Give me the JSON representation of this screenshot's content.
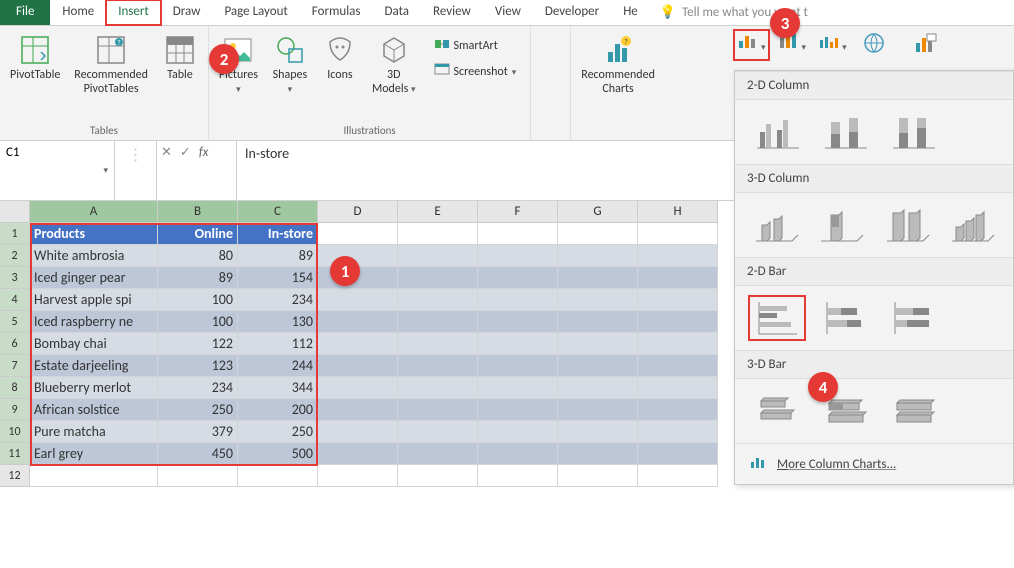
{
  "tabs": {
    "file": "File",
    "home": "Home",
    "insert": "Insert",
    "draw": "Draw",
    "pagelayout": "Page Layout",
    "formulas": "Formulas",
    "data": "Data",
    "review": "Review",
    "view": "View",
    "developer": "Developer",
    "help": "He",
    "tellme": "Tell me what you want t"
  },
  "ribbon": {
    "pivottable": "PivotTable",
    "recpivot": "Recommended\nPivotTables",
    "table": "Table",
    "tables_label": "Tables",
    "pictures": "Pictures",
    "shapes": "Shapes",
    "icons": "Icons",
    "models3d": "3D\nModels",
    "illus_label": "Illustrations",
    "smartart": "SmartArt",
    "screenshot": "Screenshot",
    "reccharts": "Recommended\nCharts"
  },
  "fmla": {
    "cellref": "C1",
    "value": "In-store"
  },
  "columns": [
    "A",
    "B",
    "C",
    "D",
    "E",
    "F",
    "G",
    "H"
  ],
  "table_header": {
    "a": "Products",
    "b": "Online",
    "c": "In-store"
  },
  "rows": [
    {
      "a": "White ambrosia",
      "b": "80",
      "c": "89"
    },
    {
      "a": "Iced ginger pear",
      "b": "89",
      "c": "154"
    },
    {
      "a": "Harvest apple spi",
      "b": "100",
      "c": "234"
    },
    {
      "a": "Iced raspberry ne",
      "b": "100",
      "c": "130"
    },
    {
      "a": "Bombay chai",
      "b": "122",
      "c": "112"
    },
    {
      "a": "Estate darjeeling",
      "b": "123",
      "c": "244"
    },
    {
      "a": "Blueberry merlot",
      "b": "234",
      "c": "344"
    },
    {
      "a": "African solstice",
      "b": "250",
      "c": "200"
    },
    {
      "a": "Pure matcha",
      "b": "379",
      "c": "250"
    },
    {
      "a": "Earl grey",
      "b": "450",
      "c": "500"
    }
  ],
  "dd": {
    "c2d": "2-D Column",
    "c3d": "3-D Column",
    "b2d": "2-D Bar",
    "b3d": "3-D Bar",
    "more": "More Column Charts...",
    "more_key": "M"
  },
  "markers": {
    "m1": "1",
    "m2": "2",
    "m3": "3",
    "m4": "4"
  }
}
